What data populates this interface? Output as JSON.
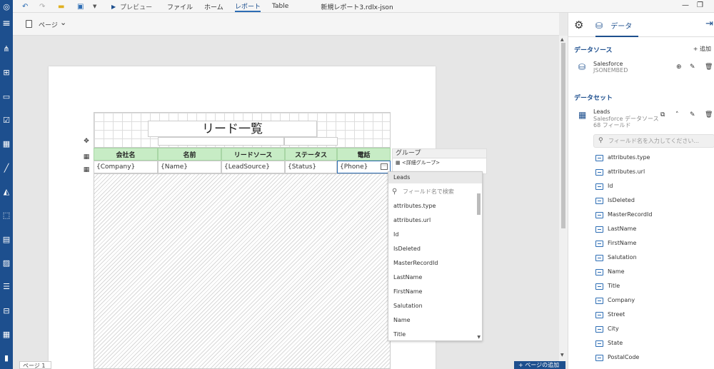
{
  "app": {
    "window_title": "新規レポート3.rdlx-json",
    "menu": [
      "ファイル",
      "ホーム",
      "レポート",
      "Table"
    ],
    "active_menu_index": 2,
    "preview_label": "プレビュー"
  },
  "toolbar": {
    "page_label": "ページ"
  },
  "report": {
    "title": "リード一覧",
    "columns": [
      "会社名",
      "名前",
      "リードソース",
      "ステータス",
      "電話"
    ],
    "cells": [
      "{Company}",
      "{Name}",
      "{LeadSource}",
      "{Status}",
      "{Phone}"
    ],
    "header_color": "#c7ecc5"
  },
  "group_popup": {
    "header": "グループ",
    "item": "<詳細グループ>"
  },
  "field_picker": {
    "header": "Leads",
    "search_placeholder": "フィールド名で検索",
    "items": [
      "attributes.type",
      "attributes.url",
      "Id",
      "IsDeleted",
      "MasterRecordId",
      "LastName",
      "FirstName",
      "Salutation",
      "Name",
      "Title"
    ]
  },
  "bottom": {
    "page_tab": "ページ 1",
    "add_page": "+ ページの追加"
  },
  "panel": {
    "tab_label": "データ",
    "datasource_title": "データソース",
    "datasource_add": "+ 追加",
    "datasource": {
      "name": "Salesforce",
      "type": "JSONEMBED"
    },
    "dataset_title": "データセット",
    "dataset": {
      "name": "Leads",
      "source": "Salesforce データソース",
      "count": "68 フィールド"
    },
    "field_search_placeholder": "フィールド名を入力してください...",
    "fields": [
      "attributes.type",
      "attributes.url",
      "Id",
      "IsDeleted",
      "MasterRecordId",
      "LastName",
      "FirstName",
      "Salutation",
      "Name",
      "Title",
      "Company",
      "Street",
      "City",
      "State",
      "PostalCode"
    ]
  },
  "colors": {
    "brand": "#1d4f8e",
    "accent": "#2d6db4"
  }
}
